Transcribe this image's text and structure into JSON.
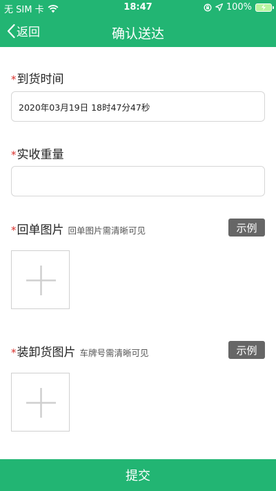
{
  "status_bar": {
    "carrier": "无 SIM 卡",
    "time": "18:47",
    "battery": "100%"
  },
  "nav": {
    "back_label": "返回",
    "title": "确认送达"
  },
  "form": {
    "required_mark": "*",
    "arrival_time": {
      "label": "到货时间",
      "value": "2020年03月19日 18时47分47秒"
    },
    "received_weight": {
      "label": "实收重量",
      "value": ""
    },
    "receipt_image": {
      "label": "回单图片",
      "hint": "回单图片需清晰可见",
      "example_label": "示例"
    },
    "loading_image": {
      "label": "装卸货图片",
      "hint": "车牌号需清晰可见",
      "example_label": "示例"
    }
  },
  "submit_label": "提交",
  "colors": {
    "brand_green": "#22b573",
    "required_red": "#d9302c",
    "example_button_gray": "#666666"
  },
  "icons": [
    "wifi-icon",
    "lock-rotation-icon",
    "location-arrow-icon",
    "battery-charging-icon",
    "chevron-left-icon",
    "plus-icon"
  ]
}
